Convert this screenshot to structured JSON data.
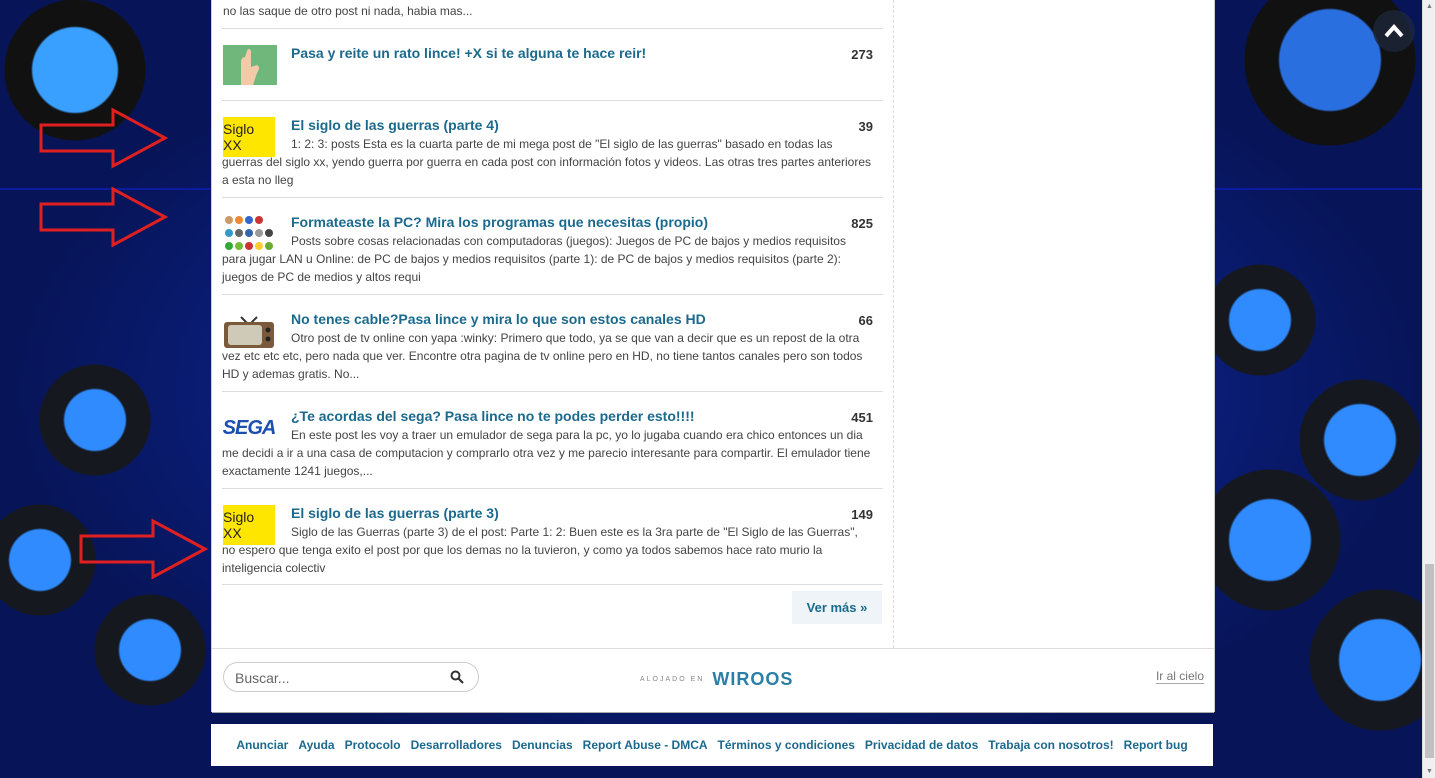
{
  "top_snippet": "no las saque de otro post ni nada, habia mas...",
  "posts": [
    {
      "title": "Pasa y reite un rato lince! +X si te alguna te hace reir!",
      "count": "273",
      "desc": "",
      "thumb": "hand-image"
    },
    {
      "title": "El siglo de las guerras (parte 4)",
      "count": "39",
      "desc": "1: 2: 3: posts Esta es la cuarta parte de mi mega post de \"El siglo de las guerras\" basado en todas las guerras del siglo xx, yendo guerra por guerra en cada post con información fotos y videos. Las otras tres partes anteriores a esta no lleg",
      "thumb_text": "Siglo XX"
    },
    {
      "title": "Formateaste la PC? Mira los programas que necesitas (propio)",
      "count": "825",
      "desc": "Posts sobre cosas relacionadas con computadoras (juegos): Juegos de PC de bajos y medios requisitos para jugar LAN u Online: de PC de bajos y medios requisitos (parte 1): de PC de bajos y medios requisitos (parte 2): juegos de PC de medios y altos requi",
      "thumb": "app-icons"
    },
    {
      "title": "No tenes cable?Pasa lince y mira lo que son estos canales HD",
      "count": "66",
      "desc": "Otro post de tv online con yapa :winky: Primero que todo, ya se que van a decir que es un repost de la otra vez etc etc etc, pero nada que ver. Encontre otra pagina de tv online pero en HD, no tiene tantos canales pero son todos HD y ademas gratis. No...",
      "thumb": "tv-image"
    },
    {
      "title": "¿Te acordas del sega? Pasa lince no te podes perder esto!!!!",
      "count": "451",
      "desc": "En este post les voy a traer un emulador de sega para la pc, yo lo jugaba cuando era chico entonces un dia me decidi a ir a una casa de computacion y comprarlo otra vez y me parecio interesante para compartir. El emulador tiene exactamente 1241 juegos,...",
      "thumb_text": "SEGA"
    },
    {
      "title": "El siglo de las guerras (parte 3)",
      "count": "149",
      "desc": "Siglo de las Guerras (parte 3) de el post: Parte 1: 2: Buen este es la 3ra parte de \"El Siglo de las Guerras\", no espero que tenga exito el post por que los demas no la tuvieron, y como ya todos sabemos hace rato murio la inteligencia colectiv",
      "thumb_text": "Siglo XX"
    }
  ],
  "more_label": "Ver más »",
  "search": {
    "placeholder": "Buscar..."
  },
  "hosted": {
    "label": "ALOJADO EN",
    "brand": "WIROOS"
  },
  "to_top_label": "Ir al cielo",
  "footer_links": [
    "Anunciar",
    "Ayuda",
    "Protocolo",
    "Desarrolladores",
    "Denuncias",
    "Report Abuse - DMCA",
    "Términos y condiciones",
    "Privacidad de datos",
    "Trabaja con nosotros!",
    "Report bug"
  ],
  "colors": {
    "link": "#1b6a8e",
    "arrow": "#e02020",
    "siglo_bg": "#ffe600"
  }
}
